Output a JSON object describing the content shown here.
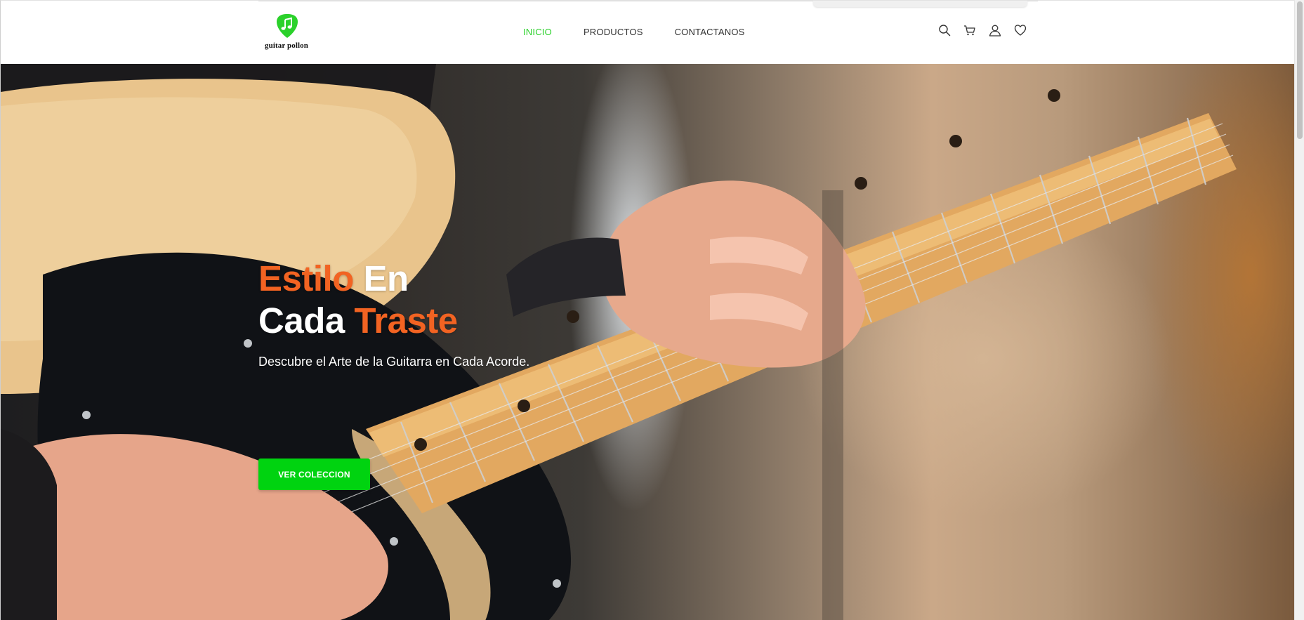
{
  "brand": {
    "name": "guitar pollon",
    "accent_color": "#2bd12b",
    "logo_icon": "music-note-pick-icon"
  },
  "nav": {
    "items": [
      {
        "label": "INICIO",
        "active": true
      },
      {
        "label": "PRODUCTOS",
        "active": false
      },
      {
        "label": "CONTACTANOS",
        "active": false
      }
    ]
  },
  "header_icons": [
    "search-icon",
    "cart-icon",
    "user-icon",
    "heart-icon"
  ],
  "hero": {
    "title_line1_accent": "Estilo",
    "title_line1_rest": " En",
    "title_line2_start": "Cada ",
    "title_line2_accent": "Traste",
    "subtitle": "Descubre el Arte de la Guitarra en Cada Acorde.",
    "button_label": "VER COLECCION",
    "title_accent_color": "#f26322",
    "button_color": "#00d310"
  }
}
